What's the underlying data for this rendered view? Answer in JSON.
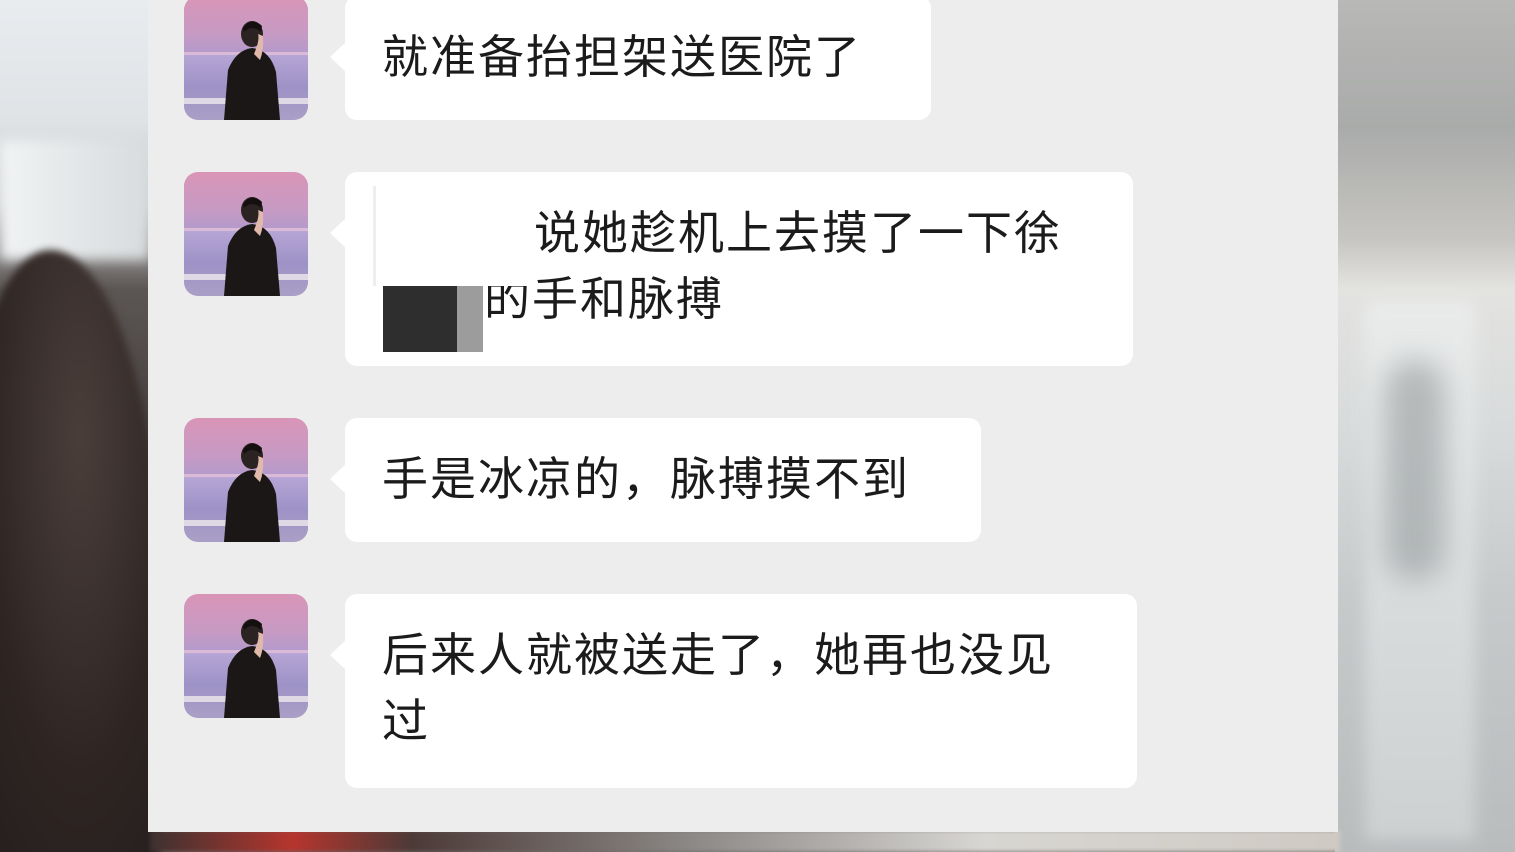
{
  "messages": [
    {
      "text": "就准备抬担架送医院了",
      "redacted": false
    },
    {
      "line1": "说她趁机上去摸了一下徐",
      "line2": "的手和脉搏",
      "redacted": true
    },
    {
      "text": "手是冰凉的，脉搏摸不到",
      "redacted": false
    },
    {
      "text": "后来人就被送走了，她再也没见过",
      "redacted": false
    }
  ],
  "colors": {
    "panel_bg": "#ededed",
    "bubble_bg": "#ffffff",
    "text": "#1b1b1b",
    "redaction": "#2e2e2e"
  },
  "icons": {
    "avatar": "avatar-photo-man-at-sea"
  }
}
